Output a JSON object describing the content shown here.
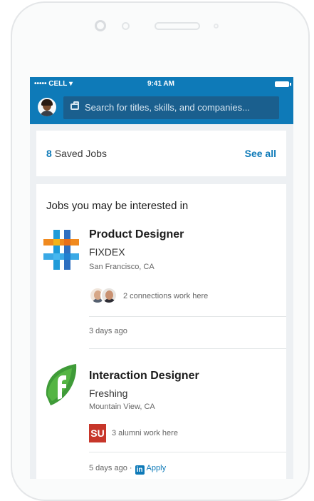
{
  "status_bar": {
    "carrier": "••••• CELL",
    "time": "9:41 AM"
  },
  "search": {
    "placeholder": "Search for titles, skills, and companies..."
  },
  "saved_jobs": {
    "count": "8",
    "label": "Saved Jobs",
    "see_all": "See all"
  },
  "recommendations": {
    "heading": "Jobs you may be interested in",
    "jobs": [
      {
        "title": "Product Designer",
        "company": "FIXDEX",
        "location": "San Francisco, CA",
        "insight": "2 connections work here",
        "posted": "3 days ago"
      },
      {
        "title": "Interaction Designer",
        "company": "Freshing",
        "location": "Mountain View, CA",
        "insight": "3 alumni work here",
        "logo_text": "SU",
        "posted": "5 days ago ·",
        "badge": "in",
        "apply": "Apply"
      }
    ]
  },
  "colors": {
    "brand_blue": "#0e7ab8",
    "search_bg": "#1a5f8e"
  }
}
